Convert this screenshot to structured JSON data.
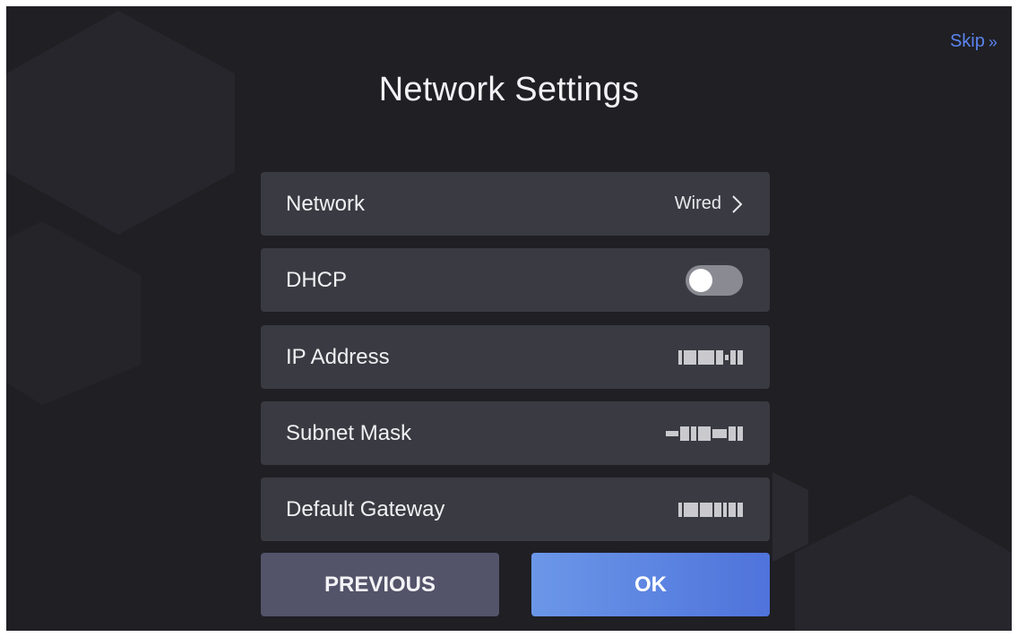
{
  "header": {
    "skip_label": "Skip",
    "skip_icon": "double-chevron-right-icon",
    "title": "Network Settings"
  },
  "rows": [
    {
      "label": "Network",
      "value": "Wired",
      "type": "select"
    },
    {
      "label": "DHCP",
      "type": "toggle",
      "enabled": false
    },
    {
      "label": "IP Address",
      "type": "masked"
    },
    {
      "label": "Subnet Mask",
      "type": "masked"
    },
    {
      "label": "Default Gateway",
      "type": "masked"
    }
  ],
  "buttons": {
    "previous_label": "PREVIOUS",
    "ok_label": "OK"
  },
  "colors": {
    "background": "#1f1f24",
    "row": "#3a3a42",
    "accent": "#5b84ee",
    "ok_start": "#6b97e8",
    "ok_end": "#4f73db",
    "previous": "#53536a"
  }
}
